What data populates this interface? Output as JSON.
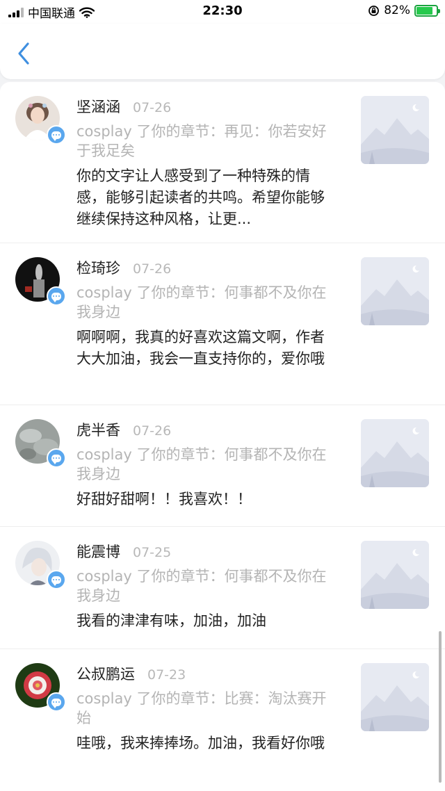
{
  "status_bar": {
    "carrier": "中国联通",
    "time": "22:30",
    "battery_percent": "82%",
    "battery_level": 0.82
  },
  "nav": {
    "back_icon": "chevron-left-icon"
  },
  "comments": [
    {
      "name": "坚涵涵",
      "date": "07-26",
      "ref": "cosplay 了你的章节：再见：你若安好于我足矣",
      "content": "你的文字让人感受到了一种特殊的情感，能够引起读者的共鸣。希望你能够继续保持这种风格，让更...",
      "avatar": "girl-portrait"
    },
    {
      "name": "检琦珍",
      "date": "07-26",
      "ref": "cosplay 了你的章节：何事都不及你在我身边",
      "content": "啊啊啊，我真的好喜欢这篇文啊，作者大大加油，我会一直支持你的，爱你哦",
      "avatar": "dark-figure"
    },
    {
      "name": "虎半香",
      "date": "07-26",
      "ref": "cosplay 了你的章节：何事都不及你在我身边",
      "content": "好甜好甜啊！！我喜欢！！",
      "avatar": "grey-texture"
    },
    {
      "name": "能震博",
      "date": "07-25",
      "ref": "cosplay 了你的章节：何事都不及你在我身边",
      "content": "我看的津津有味，加油，加油",
      "avatar": "white-hair-character"
    },
    {
      "name": "公叔鹏运",
      "date": "07-23",
      "ref": "cosplay 了你的章节：比赛：淘汰赛开始",
      "content": "哇哦，我来捧捧场。加油，我看好你哦",
      "avatar": "red-flower"
    }
  ],
  "colors": {
    "accent": "#5aa7ee",
    "name_text": "#222222",
    "secondary_text": "#b4b4b4"
  }
}
